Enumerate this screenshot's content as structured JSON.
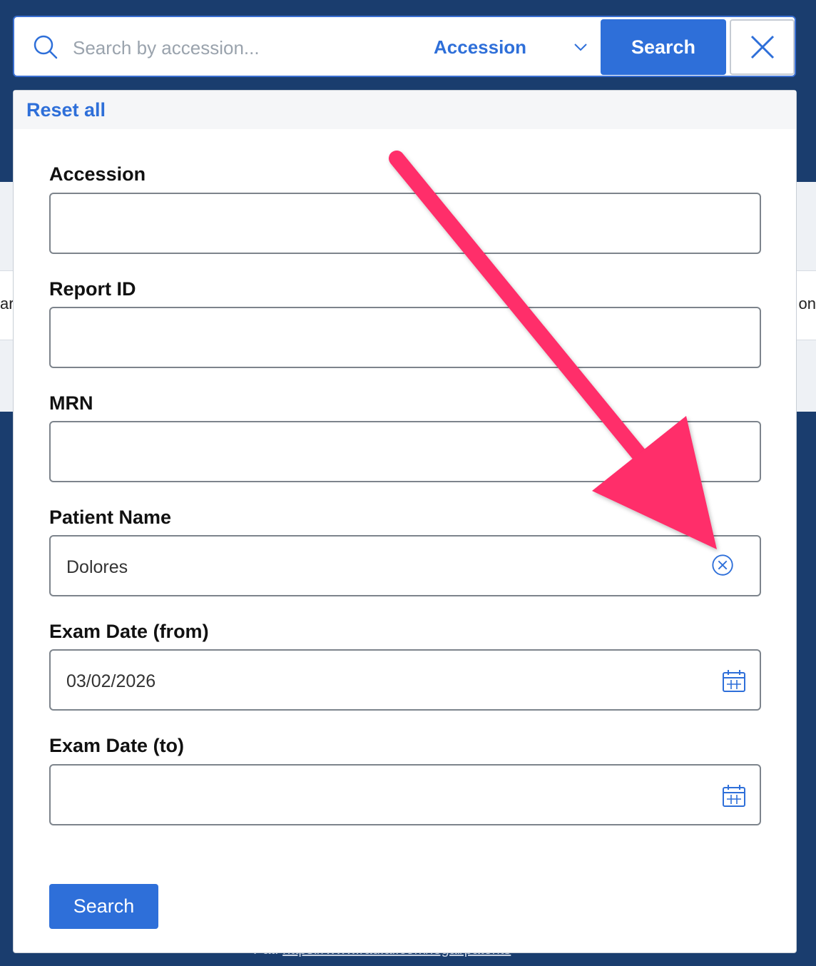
{
  "background": {
    "left_fragment": "ar",
    "right_fragment": "on",
    "footer_prefix": "Pat. ",
    "footer_link": "https://www.rad.ai.com/legal/patents"
  },
  "topbar": {
    "search_icon": "search-icon",
    "search_placeholder": "Search by accession...",
    "mode_selected": "Accession",
    "mode_icon": "chevron-down-icon",
    "search_label": "Search",
    "close_icon": "close-icon"
  },
  "panel": {
    "reset_label": "Reset all",
    "fields": [
      {
        "label": "Accession",
        "value": "",
        "placeholder": ""
      },
      {
        "label": "Report ID",
        "value": "",
        "placeholder": ""
      },
      {
        "label": "MRN",
        "value": "",
        "placeholder": ""
      },
      {
        "label": "Patient Name",
        "value": "Dolores",
        "placeholder": "",
        "icon": "clear-circle-icon"
      },
      {
        "label": "Exam Date (from)",
        "value": "03/02/2026",
        "placeholder": "",
        "icon": "calendar-icon"
      },
      {
        "label": "Exam Date (to)",
        "value": "",
        "placeholder": "",
        "icon": "calendar-icon"
      }
    ],
    "search_label": "Search"
  },
  "colors": {
    "accent": "#2e6fd9",
    "page_background": "#1a3d6e",
    "annotation_arrow": "#ff2d6a"
  }
}
